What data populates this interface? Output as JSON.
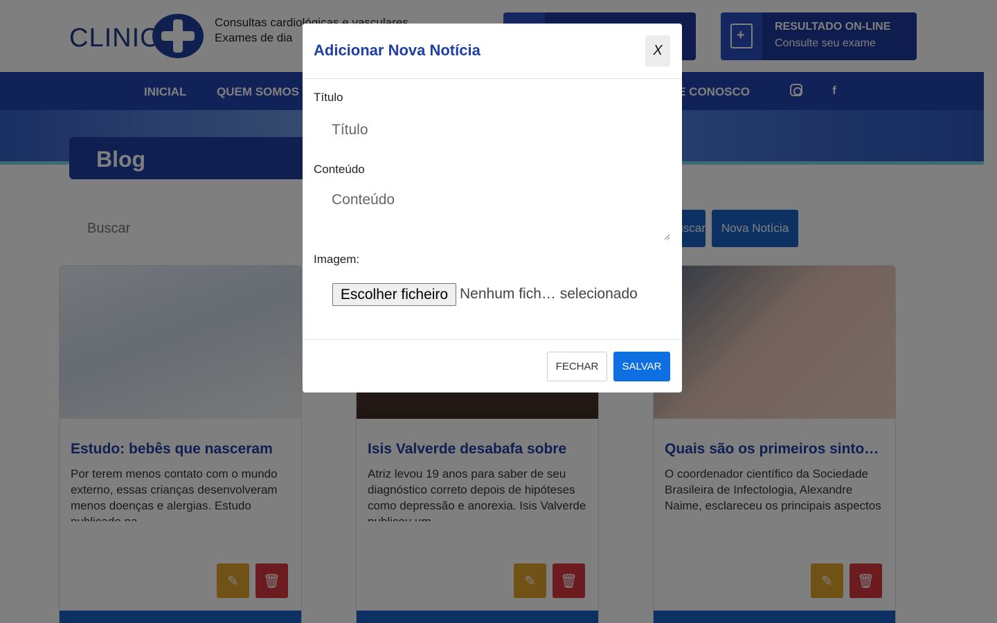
{
  "header": {
    "logo_text": "CLINIC",
    "tagline_line1": "Consultas cardiológicas e vasculares",
    "tagline_line2": "Exames de dia",
    "cta1_title": "",
    "cta1_sub": "",
    "cta2_title": "RESULTADO ON-LINE",
    "cta2_sub": "Consulte seu exame"
  },
  "nav": {
    "items": [
      "INICIAL",
      "QUEM SOMOS",
      "FALE CONOSCO"
    ],
    "icons": [
      "instagram-icon",
      "facebook-icon"
    ]
  },
  "page": {
    "title": "Blog"
  },
  "search": {
    "placeholder": "Buscar",
    "button": "Buscar",
    "new_button": "Nova Notícia"
  },
  "cards": [
    {
      "title": "Estudo: bebês que nasceram",
      "text": "Por terem menos contato com o mundo externo, essas crianças desenvolveram menos doenças e alergias. Estudo publicado na"
    },
    {
      "title": "Isis Valverde desabafa sobre",
      "text": "Atriz levou 19 anos para saber de seu diagnóstico correto depois de hipóteses como depressão e anorexia. Isis Valverde publicou um"
    },
    {
      "title": "Quais são os primeiros sintomas",
      "text": "O coordenador científico da Sociedade Brasileira de Infectologia, Alexandre Naime, esclareceu os principais aspectos"
    }
  ],
  "modal": {
    "title": "Adicionar Nova Notícia",
    "close": "X",
    "titulo_label": "Título",
    "titulo_placeholder": "Título",
    "conteudo_label": "Conteúdo",
    "conteudo_placeholder": "Conteúdo",
    "imagem_label": "Imagem:",
    "file_button": "Escolher ficheiro",
    "file_status": "Nenhum fich… selecionado",
    "fechar": "FECHAR",
    "salvar": "SALVAR"
  },
  "colors": {
    "brand": "#1f3fa3",
    "nav": "#2345b3",
    "primary": "#1a63c7",
    "edit": "#e0a52f",
    "delete": "#d9363e"
  }
}
